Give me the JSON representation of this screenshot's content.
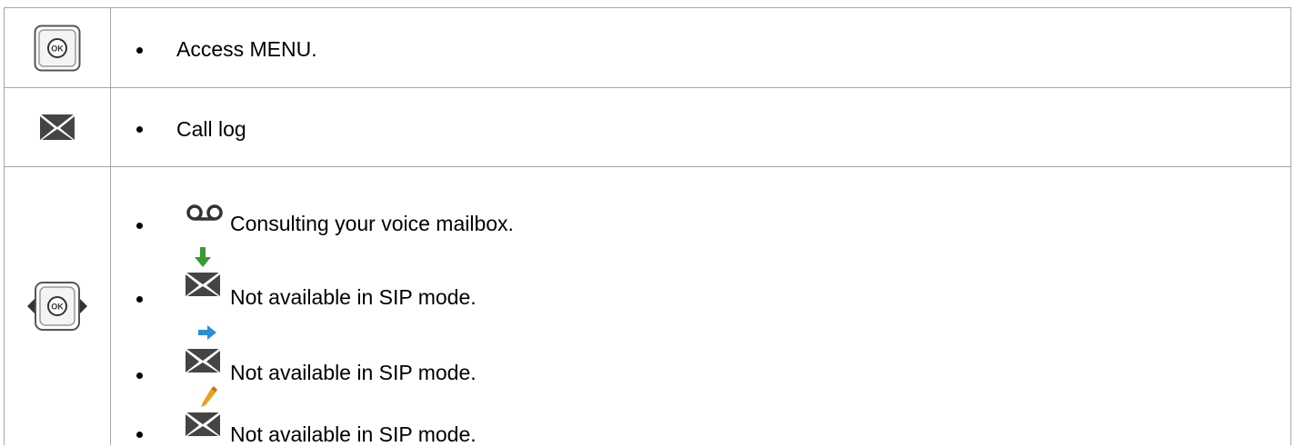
{
  "rows": [
    {
      "key_icon": "ok-button-key-icon",
      "items": [
        {
          "text": "Access MENU."
        }
      ]
    },
    {
      "key_icon": "envelope-key-icon",
      "items": [
        {
          "text": "Call log"
        }
      ]
    },
    {
      "key_icon": "ok-navigator-left-right-key-icon",
      "items": [
        {
          "icon": "voicemail-icon",
          "text": "Consulting your voice mailbox."
        },
        {
          "icon": "envelope-incoming-arrow-icon",
          "text": "Not available in SIP mode."
        },
        {
          "icon": "envelope-forward-arrow-icon",
          "text": "Not available in SIP mode."
        },
        {
          "icon": "envelope-pencil-icon",
          "text": "Not available in SIP mode."
        }
      ]
    }
  ],
  "colors": {
    "border": "#a6a6a6",
    "green_arrow": "#3a9a35",
    "blue_arrow": "#2a8fd6",
    "pencil": "#e8a020",
    "icon_dark": "#333333"
  }
}
